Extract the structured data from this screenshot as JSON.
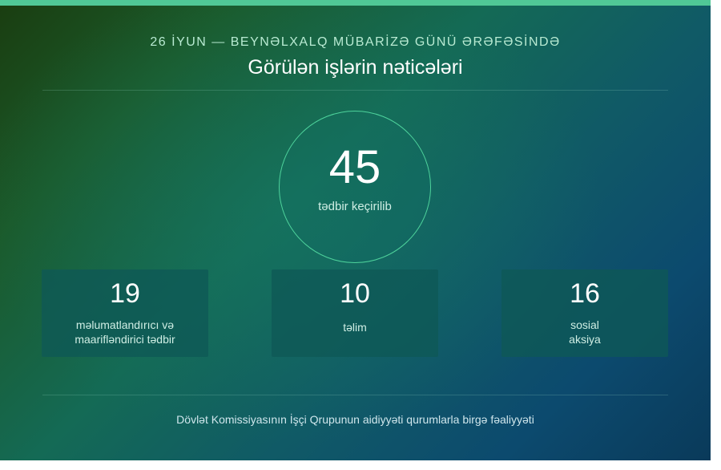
{
  "colors": {
    "accent_bar": "#50c896",
    "circle_border": "#4ed39c"
  },
  "header": {
    "kicker": "26 İYUN — BEYNƏLXALQ MÜBARİZƏ GÜNÜ ƏRƏFƏSİNDƏ",
    "title": "Görülən işlərin nəticələri"
  },
  "hero": {
    "value": "45",
    "label": "tədbir keçirilib"
  },
  "stats": [
    {
      "value": "19",
      "label_lines": [
        "məlumatlandırıcı və",
        "maarifləndirici tədbir"
      ]
    },
    {
      "value": "10",
      "label_lines": [
        "təlim"
      ]
    },
    {
      "value": "16",
      "label_lines": [
        "sosial",
        "aksiya"
      ]
    }
  ],
  "footer": {
    "text": "Dövlət Komissiyasının İşçi Qrupunun aidiyyəti qurumlarla birgə fəaliyyəti"
  }
}
